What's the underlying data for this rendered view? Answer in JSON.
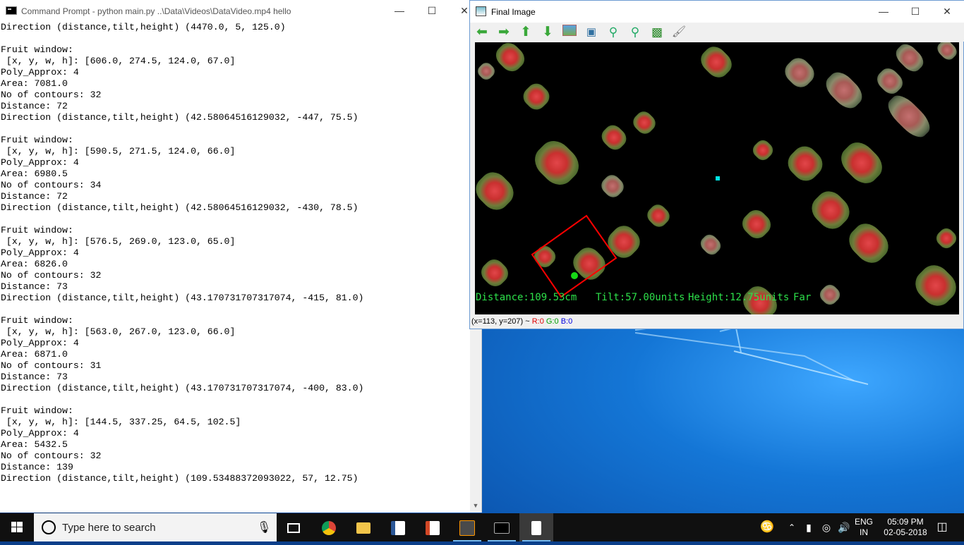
{
  "cmd": {
    "title": "Command Prompt - python  main.py ..\\Data\\Videos\\DataVideo.mp4 hello",
    "lines": [
      "Direction (distance,tilt,height) (4470.0, 5, 125.0)",
      "",
      "Fruit window:",
      " [x, y, w, h]: [606.0, 274.5, 124.0, 67.0]",
      "Poly_Approx: 4",
      "Area: 7081.0",
      "No of contours: 32",
      "Distance: 72",
      "Direction (distance,tilt,height) (42.58064516129032, -447, 75.5)",
      "",
      "Fruit window:",
      " [x, y, w, h]: [590.5, 271.5, 124.0, 66.0]",
      "Poly_Approx: 4",
      "Area: 6980.5",
      "No of contours: 34",
      "Distance: 72",
      "Direction (distance,tilt,height) (42.58064516129032, -430, 78.5)",
      "",
      "Fruit window:",
      " [x, y, w, h]: [576.5, 269.0, 123.0, 65.0]",
      "Poly_Approx: 4",
      "Area: 6826.0",
      "No of contours: 32",
      "Distance: 73",
      "Direction (distance,tilt,height) (43.170731707317074, -415, 81.0)",
      "",
      "Fruit window:",
      " [x, y, w, h]: [563.0, 267.0, 123.0, 66.0]",
      "Poly_Approx: 4",
      "Area: 6871.0",
      "No of contours: 31",
      "Distance: 73",
      "Direction (distance,tilt,height) (43.170731707317074, -400, 83.0)",
      "",
      "Fruit window:",
      " [x, y, w, h]: [144.5, 337.25, 64.5, 102.5]",
      "Poly_Approx: 4",
      "Area: 5432.5",
      "No of contours: 32",
      "Distance: 139",
      "Direction (distance,tilt,height) (109.53488372093022, 57, 12.75)"
    ]
  },
  "final_image": {
    "title": "Final Image",
    "overlay": {
      "distance": "Distance:109.53cm",
      "tilt": "Tilt:57.00units",
      "height": "Height:12.75units",
      "far": "Far"
    },
    "status": {
      "coords": "(x=113, y=207) ~",
      "r": "R:0",
      "g": "G:0",
      "b": "B:0"
    },
    "toolbar_icons": [
      "arrow-left-icon",
      "arrow-right-icon",
      "arrow-up-icon",
      "arrow-down-icon",
      "image-icon",
      "zoom-window-icon",
      "zoom-in-icon",
      "zoom-out-icon",
      "save-icon",
      "properties-icon"
    ]
  },
  "taskbar": {
    "search_placeholder": "Type here to search",
    "lang_top": "ENG",
    "lang_bottom": "IN",
    "time": "05:09 PM",
    "date": "02-05-2018"
  },
  "colors": {
    "overlay_green": "#2de04a",
    "detection_box": "#ff0000",
    "centroid_cyan": "#00e5e5"
  }
}
